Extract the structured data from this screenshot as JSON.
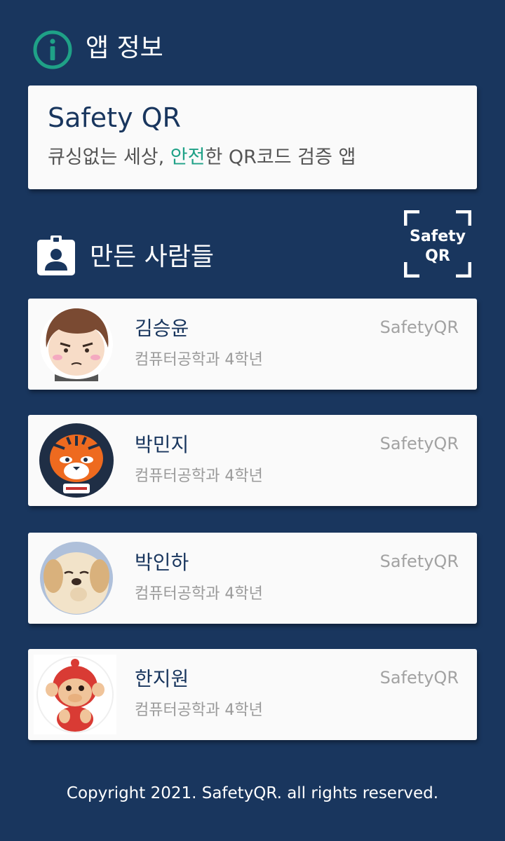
{
  "header": {
    "title": "앱 정보",
    "icon": "info-icon"
  },
  "app": {
    "name": "Safety QR",
    "tagline_pre": "큐싱없는 세상, ",
    "tagline_accent": "안전",
    "tagline_post": "한 QR코드 검증 앱"
  },
  "makers": {
    "title": "만든 사람들",
    "icon": "badge-icon",
    "logo_line1": "Safety",
    "logo_line2": "QR",
    "members": [
      {
        "name": "김승윤",
        "dept": "컴퓨터공학과 4학년",
        "tag": "SafetyQR",
        "avatar": "cartoon-boy-avatar"
      },
      {
        "name": "박민지",
        "dept": "컴퓨터공학과 4학년",
        "tag": "SafetyQR",
        "avatar": "tiger-mascot-avatar"
      },
      {
        "name": "박인하",
        "dept": "컴퓨터공학과 4학년",
        "tag": "SafetyQR",
        "avatar": "puppy-photo-avatar"
      },
      {
        "name": "한지원",
        "dept": "컴퓨터공학과 4학년",
        "tag": "SafetyQR",
        "avatar": "red-monkey-avatar"
      }
    ]
  },
  "footer": {
    "copyright": "Copyright 2021. SafetyQR. all rights reserved."
  },
  "colors": {
    "background": "#19365E",
    "card": "#FAFAFA",
    "accent": "#1FA187",
    "name_text": "#19365E"
  }
}
